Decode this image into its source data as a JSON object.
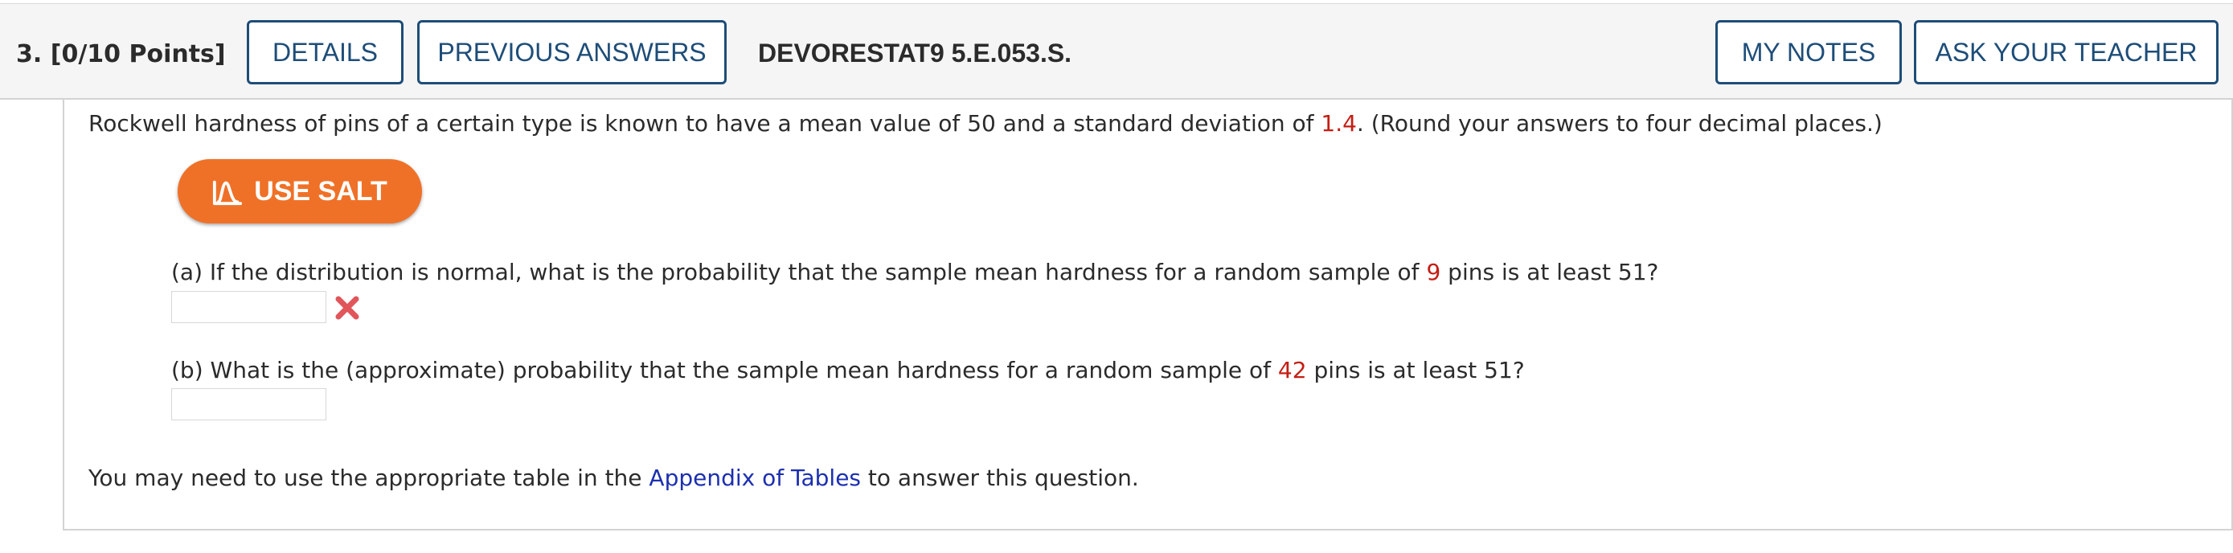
{
  "header": {
    "question_number": "3.",
    "points": "[0/10 Points]",
    "details_label": "DETAILS",
    "previous_answers_label": "PREVIOUS ANSWERS",
    "problem_code": "DEVORESTAT9 5.E.053.S.",
    "my_notes_label": "MY NOTES",
    "ask_teacher_label": "ASK YOUR TEACHER"
  },
  "problem": {
    "intro_before": "Rockwell hardness of pins of a certain type is known to have a mean value of 50 and a standard deviation of ",
    "sd_value": "1.4",
    "intro_after": ". (Round your answers to four decimal places.)",
    "salt_label": "USE SALT",
    "part_a_before": "(a) If the distribution is normal, what is the probability that the sample mean hardness for a random sample of ",
    "part_a_n": "9",
    "part_a_after": " pins is at least 51?",
    "part_a_answer": "",
    "part_a_status": "incorrect",
    "part_b_before": "(b) What is the (approximate) probability that the sample mean hardness for a random sample of ",
    "part_b_n": "42",
    "part_b_after": " pins is at least 51?",
    "part_b_answer": "",
    "footer_before": "You may need to use the appropriate table in the ",
    "footer_link": "Appendix of Tables",
    "footer_after": " to answer this question."
  },
  "colors": {
    "accent_blue": "#1e4d78",
    "salt_orange": "#ef7127",
    "highlight_red": "#c41e14",
    "link_blue": "#1c2fb0",
    "error_red": "#e0565b"
  },
  "icons": [
    "salt-icon",
    "incorrect-x-icon"
  ]
}
